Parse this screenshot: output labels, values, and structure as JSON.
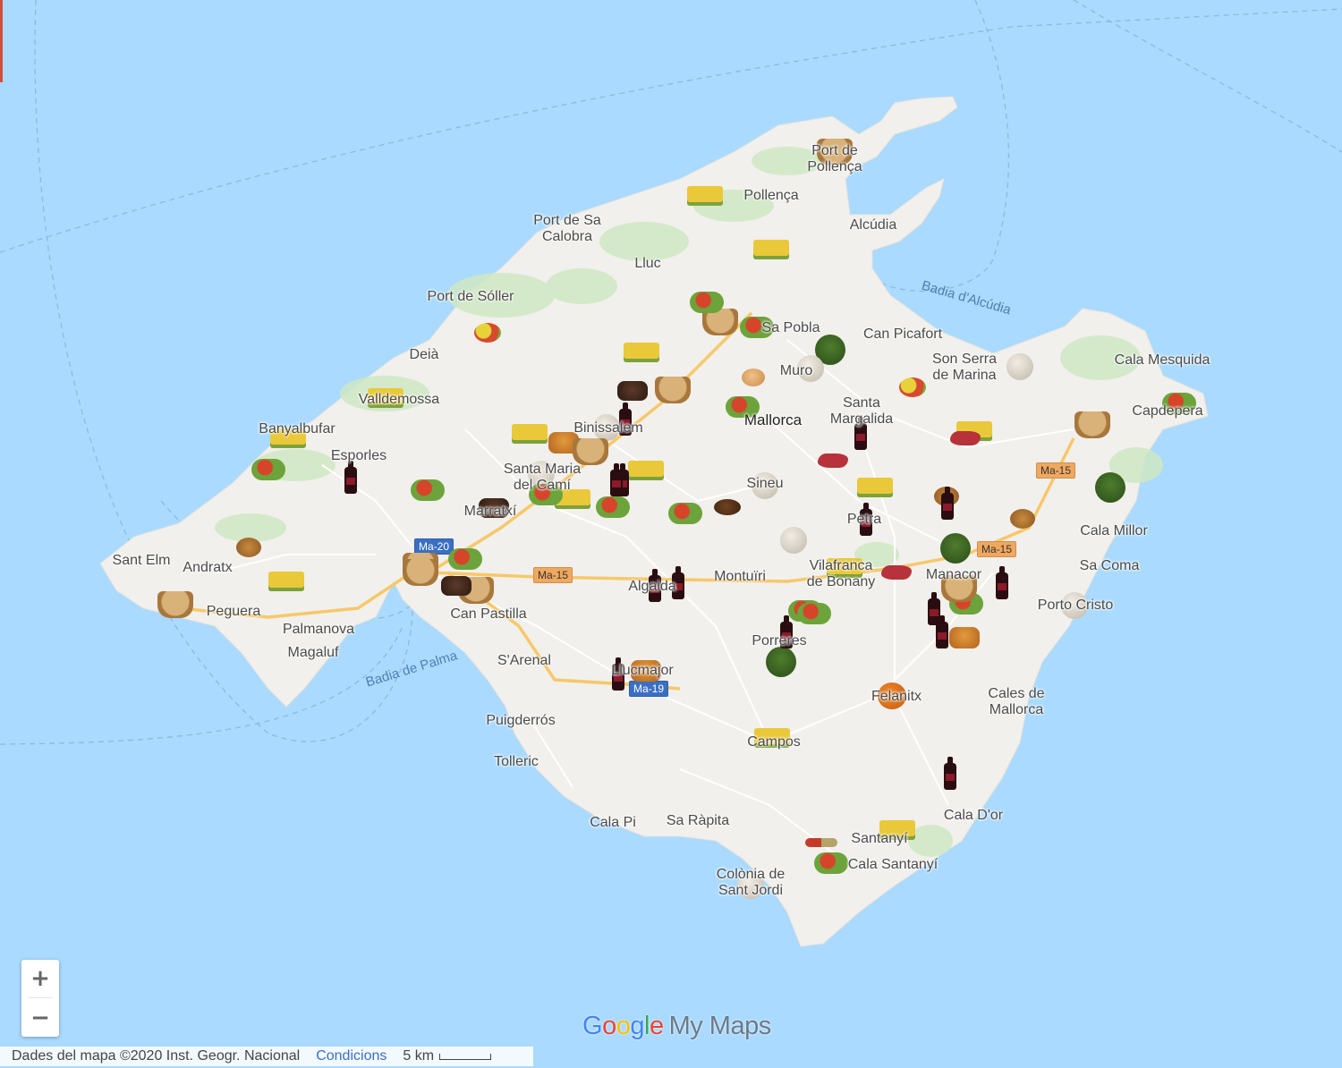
{
  "map": {
    "water_labels": [
      "Badia d'Alcúdia",
      "Badia de Palma"
    ],
    "places": [
      {
        "name": "Port de\nPollença"
      },
      {
        "name": "Pollença"
      },
      {
        "name": "Alcúdia"
      },
      {
        "name": "Port de Sa\nCalobra"
      },
      {
        "name": "Lluc"
      },
      {
        "name": "Port de Sóller"
      },
      {
        "name": "Deià"
      },
      {
        "name": "Valldemossa"
      },
      {
        "name": "Banyalbufar"
      },
      {
        "name": "Esporles"
      },
      {
        "name": "Sant Elm"
      },
      {
        "name": "Andratx"
      },
      {
        "name": "Peguera"
      },
      {
        "name": "Palmanova"
      },
      {
        "name": "Magaluf"
      },
      {
        "name": "Can Pastilla"
      },
      {
        "name": "S'Arenal"
      },
      {
        "name": "Llucmajor"
      },
      {
        "name": "Puigderrós"
      },
      {
        "name": "Tolleric"
      },
      {
        "name": "Cala Pi"
      },
      {
        "name": "Sa Ràpita"
      },
      {
        "name": "Colònia de\nSant Jordi"
      },
      {
        "name": "Santanyí"
      },
      {
        "name": "Cala Santanyí"
      },
      {
        "name": "Cala D'or"
      },
      {
        "name": "Cales de\nMallorca"
      },
      {
        "name": "Felanitx"
      },
      {
        "name": "Campos"
      },
      {
        "name": "Porreres"
      },
      {
        "name": "Montuïri"
      },
      {
        "name": "Algaida"
      },
      {
        "name": "Vilafranca\nde Bonany"
      },
      {
        "name": "Manacor"
      },
      {
        "name": "Petra"
      },
      {
        "name": "Sineu"
      },
      {
        "name": "Santa\nMargalida"
      },
      {
        "name": "Mallorca"
      },
      {
        "name": "Muro"
      },
      {
        "name": "Sa Pobla"
      },
      {
        "name": "Can Picafort"
      },
      {
        "name": "Son Serra\nde Marina"
      },
      {
        "name": "Cala Mesquida"
      },
      {
        "name": "Capdepera"
      },
      {
        "name": "Cala Millor"
      },
      {
        "name": "Sa Coma"
      },
      {
        "name": "Porto Cristo"
      },
      {
        "name": "Binissalem"
      },
      {
        "name": "Santa Maria\ndel Camí"
      },
      {
        "name": "Marratxí"
      }
    ],
    "road_shields": [
      {
        "label": "Ma-15",
        "color": "orange"
      },
      {
        "label": "Ma-15",
        "color": "orange"
      },
      {
        "label": "Ma-15",
        "color": "orange"
      },
      {
        "label": "Ma-19",
        "color": "blue"
      },
      {
        "label": "Ma-20",
        "color": "blue"
      }
    ],
    "markers": [
      {
        "icon": "basket-icon"
      },
      {
        "icon": "cheese-icon"
      },
      {
        "icon": "cheese-icon"
      },
      {
        "icon": "cheese-icon"
      },
      {
        "icon": "veg-icon"
      },
      {
        "icon": "basket-icon"
      },
      {
        "icon": "veg-icon"
      },
      {
        "icon": "fruit-icon"
      },
      {
        "icon": "cheese-icon"
      },
      {
        "icon": "lettuce-icon"
      },
      {
        "icon": "bread-icon"
      },
      {
        "icon": "eggs-icon"
      },
      {
        "icon": "chocolate-icon"
      },
      {
        "icon": "basket-icon"
      },
      {
        "icon": "veg-icon"
      },
      {
        "icon": "cheese-icon"
      },
      {
        "icon": "veg-icon"
      },
      {
        "icon": "fruit-icon"
      },
      {
        "icon": "cheese-icon"
      },
      {
        "icon": "bread-icon"
      },
      {
        "icon": "wine-icon"
      },
      {
        "icon": "pastry-icon"
      },
      {
        "icon": "basket-icon"
      },
      {
        "icon": "bread-icon"
      },
      {
        "icon": "cheese-icon"
      },
      {
        "icon": "wine-icon"
      },
      {
        "icon": "veg-icon"
      },
      {
        "icon": "cheese-icon"
      },
      {
        "icon": "chocolate-icon"
      },
      {
        "icon": "veg-icon"
      },
      {
        "icon": "veg-icon"
      },
      {
        "icon": "veg-icon"
      },
      {
        "icon": "coffee-icon"
      },
      {
        "icon": "bread-icon"
      },
      {
        "icon": "meat-icon"
      },
      {
        "icon": "wine-icon"
      },
      {
        "icon": "cheese-icon"
      },
      {
        "icon": "nuts-icon"
      },
      {
        "icon": "cheese-icon"
      },
      {
        "icon": "basket-icon"
      },
      {
        "icon": "basket-icon"
      },
      {
        "icon": "veg-icon"
      },
      {
        "icon": "wine-icon"
      },
      {
        "icon": "wine-icon"
      },
      {
        "icon": "cheese-icon"
      },
      {
        "icon": "meat-icon"
      },
      {
        "icon": "lettuce-icon"
      },
      {
        "icon": "nuts-icon"
      },
      {
        "icon": "wine-icon"
      },
      {
        "icon": "bread-icon"
      },
      {
        "icon": "wine-icon"
      },
      {
        "icon": "cheese-icon"
      },
      {
        "icon": "meat-icon"
      },
      {
        "icon": "basket-icon"
      },
      {
        "icon": "veg-icon"
      },
      {
        "icon": "veg-icon"
      },
      {
        "icon": "lettuce-icon"
      },
      {
        "icon": "bread-icon"
      },
      {
        "icon": "wine-icon"
      },
      {
        "icon": "veg-icon"
      },
      {
        "icon": "lettuce-icon"
      },
      {
        "icon": "wine-icon"
      },
      {
        "icon": "pastry-icon"
      },
      {
        "icon": "basket-icon"
      },
      {
        "icon": "wine-icon"
      },
      {
        "icon": "veg-icon"
      },
      {
        "icon": "pastry-icon"
      },
      {
        "icon": "wine-icon"
      },
      {
        "icon": "wine-icon"
      },
      {
        "icon": "wine-icon"
      },
      {
        "icon": "oranges-icon"
      },
      {
        "icon": "cheese-icon"
      },
      {
        "icon": "wine-icon"
      },
      {
        "icon": "bread-icon"
      },
      {
        "icon": "spice-icon"
      },
      {
        "icon": "veg-icon"
      },
      {
        "icon": "cheese-icon"
      },
      {
        "icon": "bread-icon"
      },
      {
        "icon": "nuts-icon"
      },
      {
        "icon": "basket-icon"
      },
      {
        "icon": "wine-icon"
      },
      {
        "icon": "basket-icon"
      },
      {
        "icon": "chocolate-icon"
      }
    ]
  },
  "controls": {
    "zoom_in": "+",
    "zoom_out": "−"
  },
  "branding": {
    "logo_letters": [
      "G",
      "o",
      "o",
      "g",
      "l",
      "e"
    ],
    "product": "My Maps"
  },
  "attribution": {
    "data_text": "Dades del mapa ©2020 Inst. Geogr. Nacional",
    "terms_link": "Condicions",
    "scale_label": "5 km"
  },
  "colors": {
    "sea": "#aadaff",
    "land": "#f1f0ec",
    "park": "#cfe8c4",
    "road_major": "#f7c86a",
    "road_minor": "#ffffff",
    "link": "#3a6fc4"
  }
}
